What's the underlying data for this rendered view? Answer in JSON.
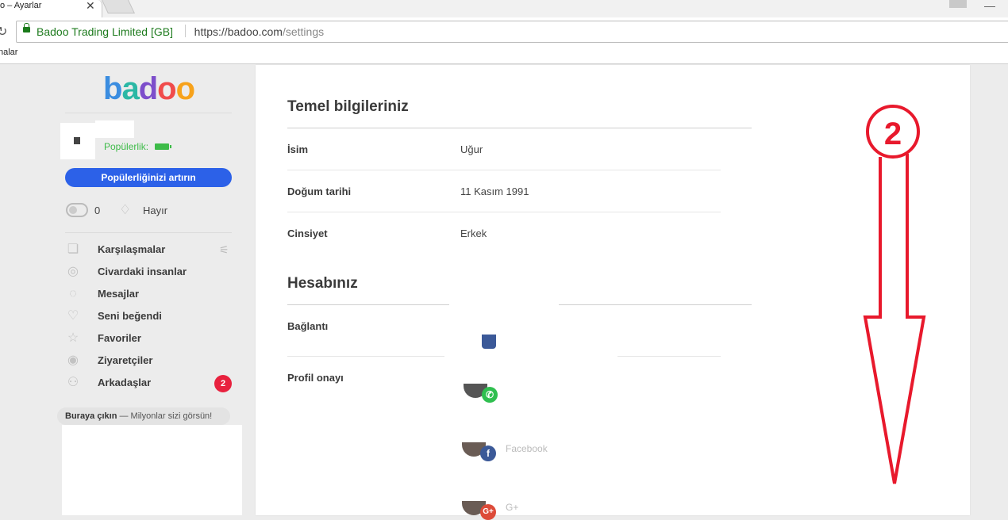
{
  "browser": {
    "tab_title": "o – Ayarlar",
    "tab_close": "✕",
    "reload_icon": "↻",
    "secure_label": "Badoo Trading Limited [GB]",
    "url_host": "https://badoo.com",
    "url_path": "/settings",
    "bookmark": "nalar"
  },
  "sidebar": {
    "logo": {
      "b": "b",
      "a": "a",
      "d": "d",
      "o1": "o",
      "o2": "o"
    },
    "popularity_label": "Popülerlik:",
    "boost_button": "Popülerliğinizi artırın",
    "credits_count": "0",
    "superpowers": "Hayır",
    "nav": [
      {
        "label": "Karşılaşmalar",
        "icon": "cards-icon"
      },
      {
        "label": "Civardaki insanlar",
        "icon": "people-nearby-icon"
      },
      {
        "label": "Mesajlar",
        "icon": "messages-icon"
      },
      {
        "label": "Seni beğendi",
        "icon": "heart-icon"
      },
      {
        "label": "Favoriler",
        "icon": "star-icon"
      },
      {
        "label": "Ziyaretçiler",
        "icon": "eye-icon"
      },
      {
        "label": "Arkadaşlar",
        "icon": "friends-icon",
        "badge": "2"
      }
    ],
    "promo_bold": "Buraya çıkın",
    "promo_rest": " — Milyonlar sizi görsün!"
  },
  "settings": {
    "basic_title": "Temel bilgileriniz",
    "fields": [
      {
        "label": "İsim",
        "value": "Uğur"
      },
      {
        "label": "Doğum tarihi",
        "value": "11 Kasım 1991"
      },
      {
        "label": "Cinsiyet",
        "value": "Erkek"
      }
    ],
    "account_title": "Hesabınız",
    "connection_label": "Bağlantı",
    "verification_label": "Profil onayı",
    "social": [
      {
        "name": "Facebook",
        "badge": "f",
        "color": "#3b5998"
      },
      {
        "name": "G+",
        "badge": "G+",
        "color": "#dd4b39"
      }
    ],
    "phone_badge_color": "#2fbf4f"
  },
  "annotation": {
    "number": "2",
    "color": "#e8192c"
  }
}
